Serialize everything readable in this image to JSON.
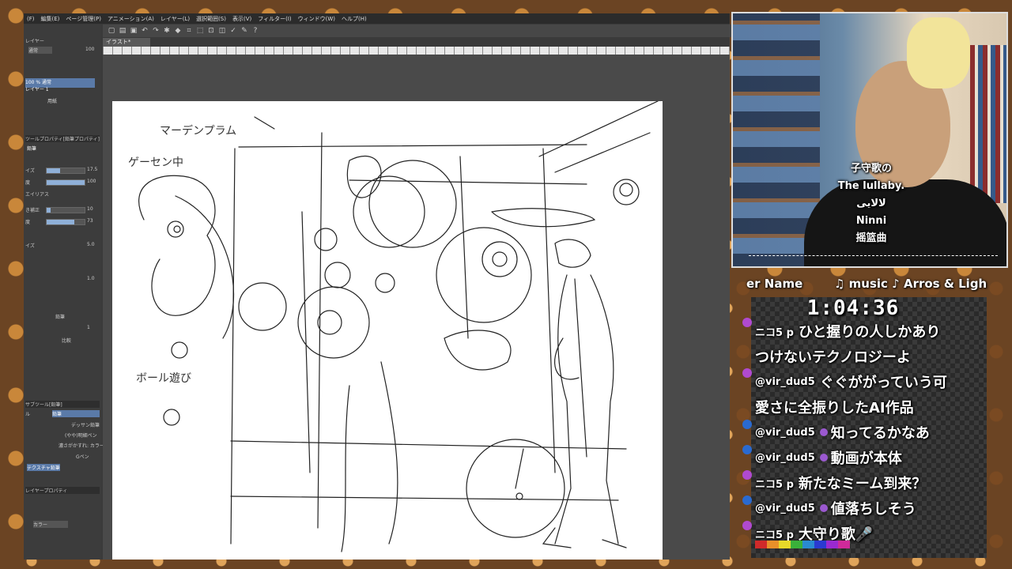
{
  "menubar": {
    "items": [
      "(F)",
      "編集(E)",
      "ページ管理(P)",
      "アニメーション(A)",
      "レイヤー(L)",
      "選択範囲(S)",
      "表示(V)",
      "フィルター(I)",
      "ウィンドウ(W)",
      "ヘルプ(H)"
    ]
  },
  "document": {
    "tab_label": "イラスト*"
  },
  "left_panel": {
    "layer_header": "レイヤー",
    "blend_mode": "通常",
    "opacity": "100",
    "layer_opacity_label": "100 % 通常",
    "layer_name": "レイヤー 1",
    "paper_layer": "用紙",
    "tool_property_header": "ツールプロパティ[鉛筆プロパティ]",
    "tool_name": "鉛筆",
    "brush_size_label": "イズ",
    "brush_size_value": "17.5",
    "density_label": "度",
    "density_value": "100",
    "antialias_label": "エイリアス",
    "stabilize_label": "き補正",
    "stabilize_value": "10",
    "hardness_label": "度",
    "hardness_value": "73",
    "size2_label": "イズ",
    "size2_value": "5.0",
    "value3": "1.0",
    "ref_label": "鉛筆",
    "value4": "1",
    "compare_label": "比較",
    "subtool_header": "サブツール[鉛筆]",
    "subtool_tab1": "ル",
    "subtool_tab2": "鉛筆",
    "brush_items": [
      "デッサン鉛筆",
      "(やや)明細ペン",
      "濃さがかすれ: カラー",
      "Gペン",
      "テクスチャ鉛筆"
    ],
    "layer_property_header": "レイヤープロパティ",
    "color_label": "カラー"
  },
  "webcam": {
    "subtitles": [
      "子守歌の",
      "The lullaby.",
      "لالایی",
      "Ninni",
      "摇篮曲"
    ]
  },
  "ticker": {
    "left_text": "er Name",
    "right_text": "♫ music ♪ Arros & Ligh"
  },
  "timer": {
    "value": "1:04:36"
  },
  "chat": [
    {
      "user": "ニコ5 p",
      "message": "ひと握りの人しかあり"
    },
    {
      "user": "",
      "message": "つけないテクノロジーよ"
    },
    {
      "user": "@vir_dud5",
      "message": "ぐぐががっていう可"
    },
    {
      "user": "",
      "message": "愛さに全振りしたAI作品"
    },
    {
      "user": "@vir_dud5",
      "message": "知ってるかなあ"
    },
    {
      "user": "@vir_dud5",
      "message": "動画が本体"
    },
    {
      "user": "ニコ5 p",
      "message": "新たなミーム到来？"
    },
    {
      "user": "@vir_dud5",
      "message": "値落ちしそう"
    },
    {
      "user": "ニコ5 p",
      "message": "大守り歌🎤"
    }
  ],
  "sketch_annotations": {
    "note1": "マーデンプラム",
    "note2": "ゲーセン中",
    "note3": "ボール遊び"
  },
  "colors": {
    "app_bg": "#3a3a3a",
    "accent": "#8fb0d8",
    "frame": "#6b4423"
  }
}
